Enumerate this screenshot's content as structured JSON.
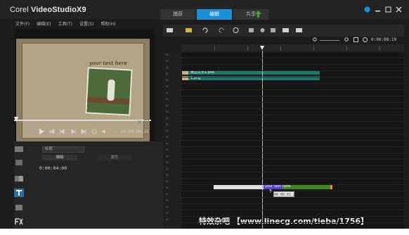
{
  "app": {
    "title_prefix": "Corel",
    "title_rest": "VideoStudioX9"
  },
  "workspace_tabs": [
    {
      "label": "捕获",
      "active": false
    },
    {
      "label": "编辑",
      "active": true
    },
    {
      "label": "共享",
      "active": false
    }
  ],
  "menu": [
    "文件(F)",
    "编辑(E)",
    "工具(T)",
    "设置(S)",
    "帮助(H)"
  ],
  "preview": {
    "overlay_text": "your text here"
  },
  "player": {
    "mode_project": "项目",
    "mode_clip": "素材",
    "timecode": "00:00:00:25"
  },
  "options": {
    "dropdown": "标题",
    "tab_edit": "编辑",
    "tab_attr": "属性",
    "duration": "0:00:04:00"
  },
  "timeline": {
    "zoom_time": "0:00:08:19",
    "clips": [
      {
        "label": "黄古文字1.psd"
      },
      {
        "label": "1.png"
      }
    ],
    "title_clip": {
      "sel_text": "your text",
      "rest": "here"
    },
    "tooltip": "00:00:01:25"
  },
  "watermark": "特效杂吧 【www.linecg.com/tieba/1756】",
  "colors": {
    "accent": "#1a8fd6",
    "clip": "#1b7a6d",
    "selected_clip": "#3e8a21",
    "selected_text": "#5b3fd1"
  }
}
